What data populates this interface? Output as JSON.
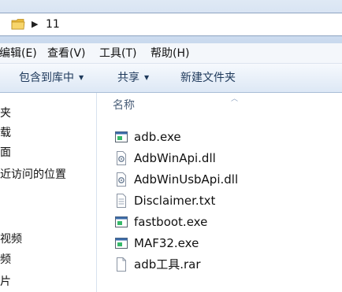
{
  "address": {
    "breadcrumb": [
      "11"
    ],
    "icon": "folder-icon"
  },
  "menu": {
    "items": [
      "编辑(E)",
      "查看(V)",
      "工具(T)",
      "帮助(H)"
    ]
  },
  "toolbar": {
    "include_library": "包含到库中",
    "share": "共享",
    "new_folder": "新建文件夹"
  },
  "nav": {
    "items": [
      "夹",
      "载",
      "面",
      "近访问的位置",
      "视频",
      "频",
      "片"
    ]
  },
  "files": {
    "column_name": "名称",
    "items": [
      {
        "name": "adb.exe",
        "icon": "exe-icon"
      },
      {
        "name": "AdbWinApi.dll",
        "icon": "dll-icon"
      },
      {
        "name": "AdbWinUsbApi.dll",
        "icon": "dll-icon"
      },
      {
        "name": "Disclaimer.txt",
        "icon": "txt-icon"
      },
      {
        "name": "fastboot.exe",
        "icon": "exe-icon"
      },
      {
        "name": "MAF32.exe",
        "icon": "exe-icon"
      },
      {
        "name": "adb工具.rar",
        "icon": "rar-icon"
      }
    ]
  },
  "colors": {
    "command_text": "#1e395b",
    "column_header": "#4c607a",
    "folder": "#f3c24b"
  }
}
